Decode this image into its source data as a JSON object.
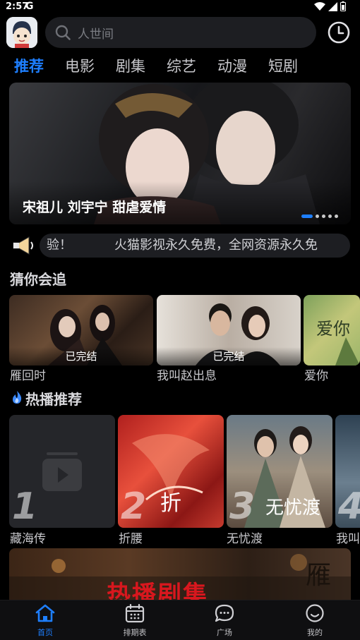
{
  "status_bar": {
    "time": "2:57",
    "g_label": "G"
  },
  "header": {
    "search_placeholder": "人世间"
  },
  "tabs": [
    {
      "label": "推荐",
      "active": true
    },
    {
      "label": "电影",
      "active": false
    },
    {
      "label": "剧集",
      "active": false
    },
    {
      "label": "综艺",
      "active": false
    },
    {
      "label": "动漫",
      "active": false
    },
    {
      "label": "短剧",
      "active": false
    }
  ],
  "banner": {
    "caption": "宋祖儿 刘宇宁 甜虐爱情",
    "page_count": 5,
    "active_page": 1
  },
  "notice": {
    "text_left": "验！",
    "text_main": "火猫影视永久免费，全网资源永久免"
  },
  "guess_section": {
    "title": "猜你会追",
    "items": [
      {
        "title": "雁回时",
        "badge": "已完结"
      },
      {
        "title": "我叫赵出息",
        "badge": "已完结"
      },
      {
        "title": "爱你",
        "badge": ""
      }
    ]
  },
  "hot_section": {
    "title": "热播推荐",
    "items": [
      {
        "rank": "1",
        "title": "藏海传"
      },
      {
        "rank": "2",
        "title": "折腰"
      },
      {
        "rank": "3",
        "title": "无忧渡"
      },
      {
        "rank": "4",
        "title": "我叫"
      }
    ]
  },
  "promo": {
    "text": "热播剧集"
  },
  "bottom_nav": [
    {
      "label": "首页",
      "icon": "home-icon",
      "active": true
    },
    {
      "label": "排期表",
      "icon": "calendar-icon",
      "active": false
    },
    {
      "label": "广场",
      "icon": "chat-icon",
      "active": false
    },
    {
      "label": "我的",
      "icon": "smile-icon",
      "active": false
    }
  ],
  "colors": {
    "accent": "#1e7fff",
    "background": "#000000",
    "surface": "#1d1e22"
  }
}
